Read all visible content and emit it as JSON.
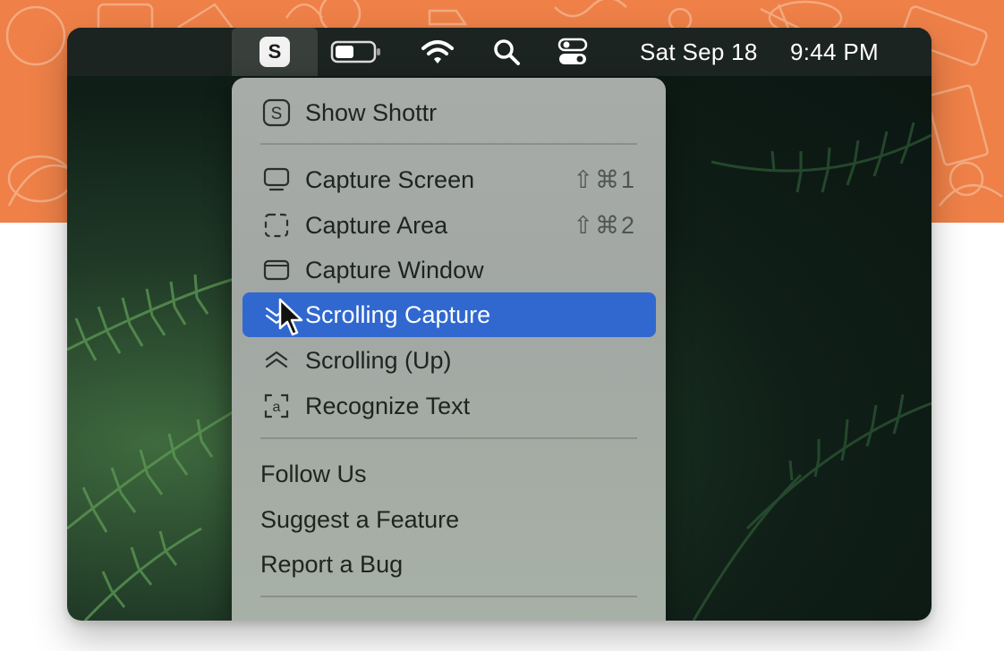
{
  "menubar": {
    "app_icon_letter": "S",
    "date": "Sat Sep 18",
    "time": "9:44 PM",
    "icons": [
      "battery-icon",
      "wifi-icon",
      "spotlight-search-icon",
      "control-center-icon"
    ]
  },
  "menu": {
    "show_shottr": {
      "label": "Show Shottr",
      "icon": "shottr-s-icon"
    },
    "capture_items": [
      {
        "label": "Capture Screen",
        "shortcut": "⇧⌘1",
        "icon": "screen-icon"
      },
      {
        "label": "Capture Area",
        "shortcut": "⇧⌘2",
        "icon": "dashed-area-icon"
      },
      {
        "label": "Capture Window",
        "shortcut": "",
        "icon": "window-icon"
      },
      {
        "label": "Scrolling Capture",
        "shortcut": "",
        "icon": "chevron-down-icon",
        "selected": true
      },
      {
        "label": "Scrolling (Up)",
        "shortcut": "",
        "icon": "chevron-up-icon"
      },
      {
        "label": "Recognize Text",
        "shortcut": "",
        "icon": "text-recognize-icon"
      }
    ],
    "links": [
      {
        "label": "Follow Us"
      },
      {
        "label": "Suggest a Feature"
      },
      {
        "label": "Report a Bug"
      }
    ]
  },
  "colors": {
    "banner": "#ee8048",
    "selection": "#3068cf",
    "menubar": "#1c2421"
  }
}
